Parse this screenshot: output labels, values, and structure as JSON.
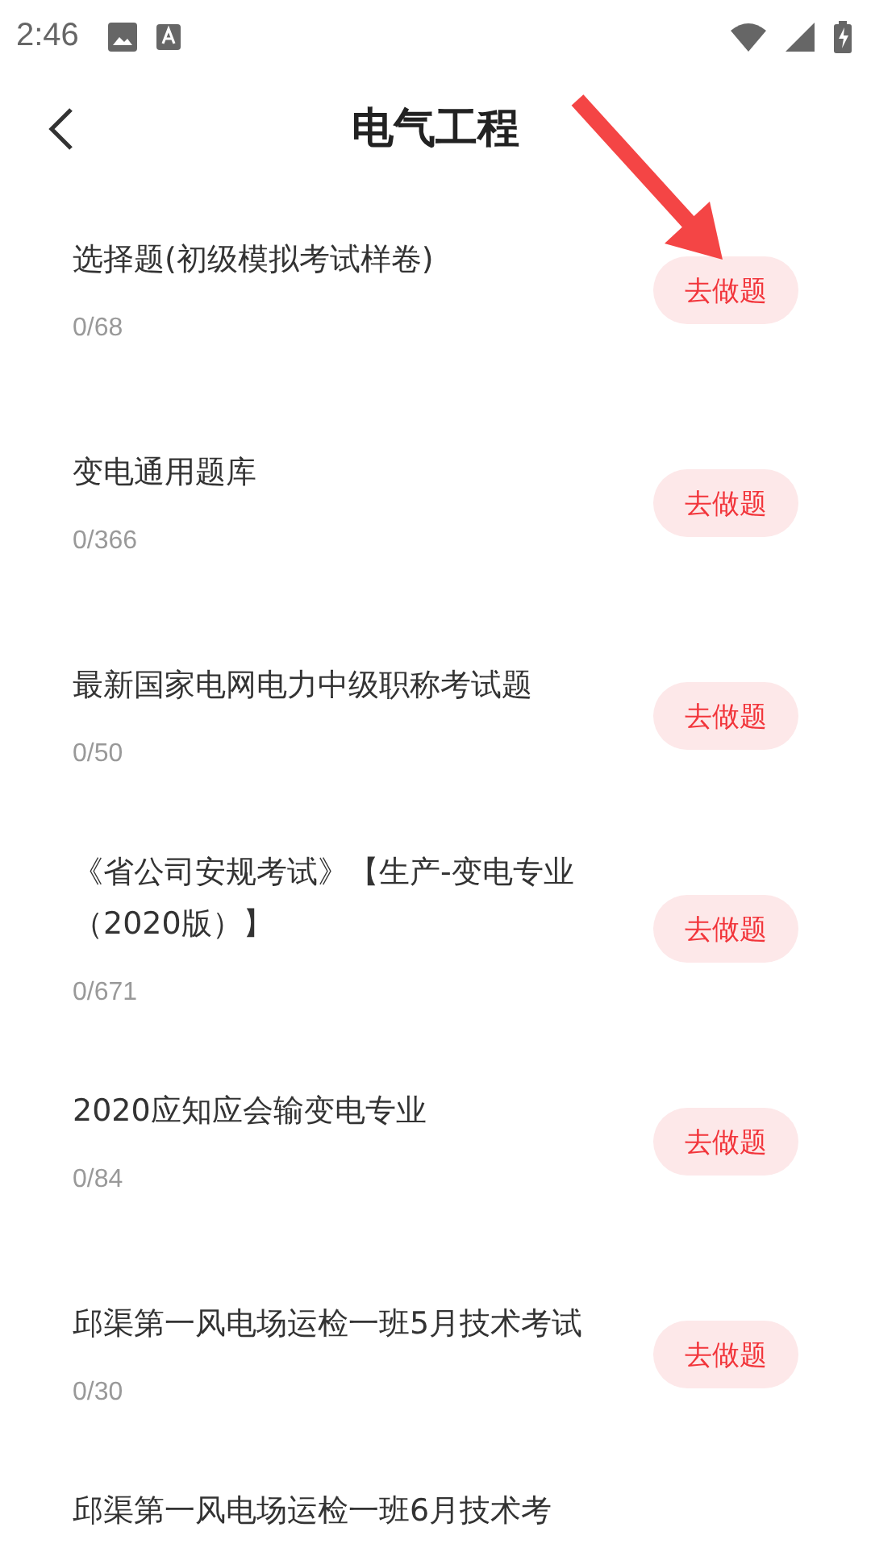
{
  "status_bar": {
    "time": "2:46"
  },
  "header": {
    "title": "电气工程"
  },
  "items": [
    {
      "title": "选择题(初级模拟考试样卷)",
      "count": "0/68",
      "action": "去做题"
    },
    {
      "title": "变电通用题库",
      "count": "0/366",
      "action": "去做题"
    },
    {
      "title": "最新国家电网电力中级职称考试题",
      "count": "0/50",
      "action": "去做题"
    },
    {
      "title": "《省公司安规考试》【生产-变电专业（2020版）】",
      "count": "0/671",
      "action": "去做题"
    },
    {
      "title": "2020应知应会输变电专业",
      "count": "0/84",
      "action": "去做题"
    },
    {
      "title": "邱渠第一风电场运检一班5月技术考试",
      "count": "0/30",
      "action": "去做题"
    },
    {
      "title": "邱渠第一风电场运检一班6月技术考"
    }
  ]
}
